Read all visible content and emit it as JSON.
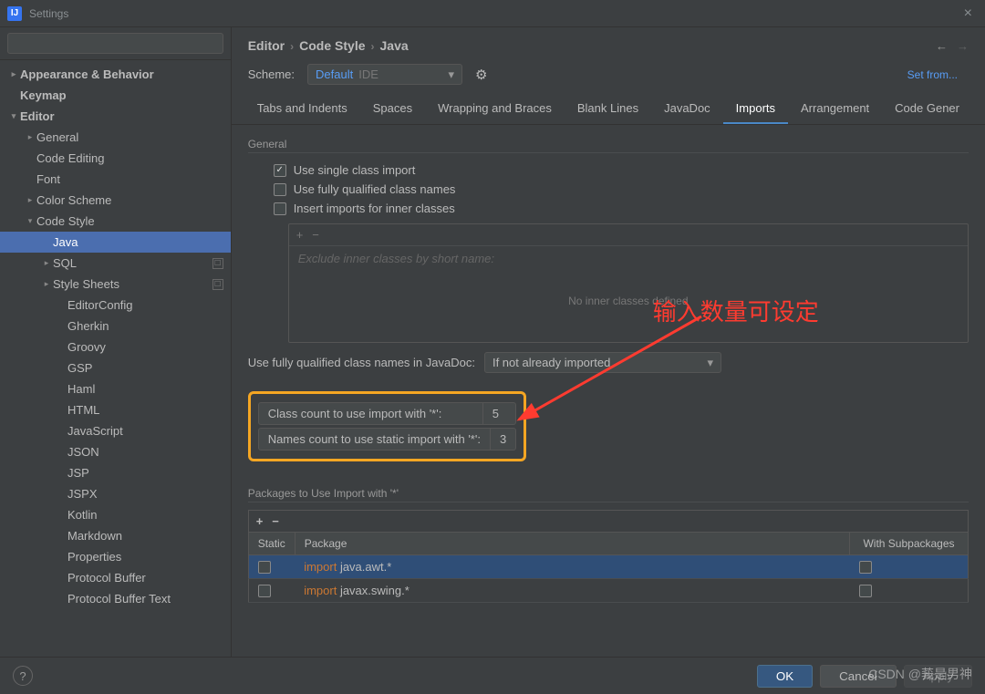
{
  "window": {
    "title": "Settings"
  },
  "search": {
    "placeholder": ""
  },
  "sidebar": {
    "items": [
      {
        "label": "Appearance & Behavior",
        "indent": 0,
        "arrow": "▸",
        "bold": true
      },
      {
        "label": "Keymap",
        "indent": 0,
        "arrow": "",
        "bold": true
      },
      {
        "label": "Editor",
        "indent": 0,
        "arrow": "▾",
        "bold": true
      },
      {
        "label": "General",
        "indent": 1,
        "arrow": "▸"
      },
      {
        "label": "Code Editing",
        "indent": 1,
        "arrow": ""
      },
      {
        "label": "Font",
        "indent": 1,
        "arrow": ""
      },
      {
        "label": "Color Scheme",
        "indent": 1,
        "arrow": "▸"
      },
      {
        "label": "Code Style",
        "indent": 1,
        "arrow": "▾"
      },
      {
        "label": "Java",
        "indent": 2,
        "arrow": "",
        "selected": true
      },
      {
        "label": "SQL",
        "indent": 2,
        "arrow": "▸",
        "badge": true
      },
      {
        "label": "Style Sheets",
        "indent": 2,
        "arrow": "▸",
        "badge": true
      },
      {
        "label": "EditorConfig",
        "indent": 3,
        "arrow": ""
      },
      {
        "label": "Gherkin",
        "indent": 3,
        "arrow": ""
      },
      {
        "label": "Groovy",
        "indent": 3,
        "arrow": ""
      },
      {
        "label": "GSP",
        "indent": 3,
        "arrow": ""
      },
      {
        "label": "Haml",
        "indent": 3,
        "arrow": ""
      },
      {
        "label": "HTML",
        "indent": 3,
        "arrow": ""
      },
      {
        "label": "JavaScript",
        "indent": 3,
        "arrow": ""
      },
      {
        "label": "JSON",
        "indent": 3,
        "arrow": ""
      },
      {
        "label": "JSP",
        "indent": 3,
        "arrow": ""
      },
      {
        "label": "JSPX",
        "indent": 3,
        "arrow": ""
      },
      {
        "label": "Kotlin",
        "indent": 3,
        "arrow": ""
      },
      {
        "label": "Markdown",
        "indent": 3,
        "arrow": ""
      },
      {
        "label": "Properties",
        "indent": 3,
        "arrow": ""
      },
      {
        "label": "Protocol Buffer",
        "indent": 3,
        "arrow": ""
      },
      {
        "label": "Protocol Buffer Text",
        "indent": 3,
        "arrow": ""
      }
    ]
  },
  "breadcrumb": [
    "Editor",
    "Code Style",
    "Java"
  ],
  "scheme": {
    "label": "Scheme:",
    "value": "Default",
    "suffix": "IDE",
    "set_from": "Set from..."
  },
  "tabs": [
    "Tabs and Indents",
    "Spaces",
    "Wrapping and Braces",
    "Blank Lines",
    "JavaDoc",
    "Imports",
    "Arrangement",
    "Code Gener"
  ],
  "tabs_active": 5,
  "general": {
    "title": "General",
    "cb1": "Use single class import",
    "cb2": "Use fully qualified class names",
    "cb3": "Insert imports for inner classes",
    "exclude_placeholder": "Exclude inner classes by short name:",
    "empty_text": "No inner classes defined"
  },
  "javadoc": {
    "label": "Use fully qualified class names in JavaDoc:",
    "value": "If not already imported"
  },
  "counts": {
    "class_label": "Class count to use import with '*':",
    "class_value": "5",
    "names_label": "Names count to use static import with '*':",
    "names_value": "3"
  },
  "packages": {
    "title": "Packages to Use Import with '*'",
    "col_static": "Static",
    "col_package": "Package",
    "col_subpkg": "With Subpackages",
    "rows": [
      {
        "kw": "import",
        "rest": " java.awt.*",
        "selected": true
      },
      {
        "kw": "import",
        "rest": " javax.swing.*",
        "selected": false
      }
    ]
  },
  "annotation_text": "输入数量可设定",
  "footer": {
    "ok": "OK",
    "cancel": "Cancel",
    "apply": "Apply"
  },
  "watermark": "CSDN @莪是男神"
}
